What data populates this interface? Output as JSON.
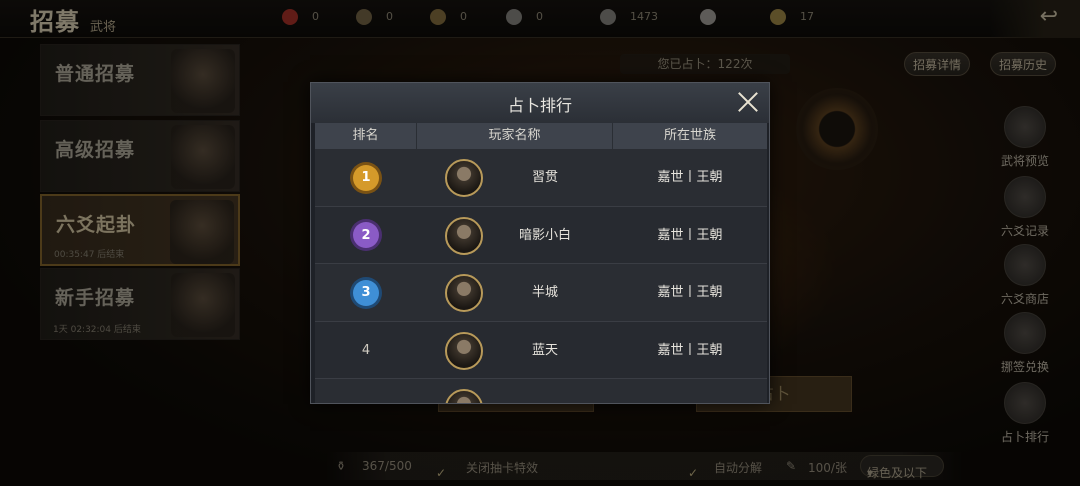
{
  "header": {
    "title": "招募",
    "subtitle": "武将",
    "resources": [
      {
        "icon": "red-token-icon",
        "value": "0",
        "color": "#b0342a"
      },
      {
        "icon": "scroll-icon",
        "value": "0",
        "color": "#7a6b4a"
      },
      {
        "icon": "book-icon",
        "value": "0",
        "color": "#8a7442"
      },
      {
        "icon": "swirl-icon",
        "value": "0",
        "color": "#8d8a86"
      },
      {
        "icon": "feather-icon",
        "value": "1473",
        "color": "#8d8a86"
      },
      {
        "icon": "ingot-silver-icon",
        "value": "",
        "color": "#a9a7a1"
      },
      {
        "icon": "ingot-gold-icon",
        "value": "17",
        "color": "#a78e4a"
      }
    ]
  },
  "recruit_tabs": [
    {
      "label": "普通招募",
      "sub": ""
    },
    {
      "label": "高级招募",
      "sub": ""
    },
    {
      "label": "六爻起卦",
      "sub": "00:35:47 后结束",
      "active": true
    },
    {
      "label": "新手招募",
      "sub": "1天 02:32:04 后结束"
    }
  ],
  "top_actions": {
    "divine_count": "您已占卜：122次",
    "details": "招募详情",
    "history": "招募历史"
  },
  "side_buttons": [
    {
      "label": "武将预览",
      "icon": "general-preview-icon"
    },
    {
      "label": "六爻记录",
      "icon": "record-icon"
    },
    {
      "label": "六爻商店",
      "icon": "shop-icon"
    },
    {
      "label": "挪签兑换",
      "icon": "exchange-icon"
    },
    {
      "label": "占卜排行",
      "icon": "ranking-icon"
    }
  ],
  "background_buttons": {
    "divine": "占卜"
  },
  "bottom": {
    "capacity": "367/500",
    "close_effect": "关闭抽卡特效",
    "auto_decompose": "自动分解",
    "price": "100/张",
    "filter": "绿色及以下"
  },
  "modal": {
    "title": "占卜排行",
    "columns": [
      "排名",
      "玩家名称",
      "所在世族"
    ],
    "rows": [
      {
        "rank": "1",
        "medal_color": "#d59a2a",
        "name": "習贯",
        "clan": "嘉世丨王朝"
      },
      {
        "rank": "2",
        "medal_color": "#8a5bc6",
        "name": "暗影小白",
        "clan": "嘉世丨王朝"
      },
      {
        "rank": "3",
        "medal_color": "#3f8fd6",
        "name": "半城",
        "clan": "嘉世丨王朝"
      },
      {
        "rank": "4",
        "medal_color": "",
        "name": "蓝天",
        "clan": "嘉世丨王朝"
      },
      {
        "rank": "",
        "medal_color": "",
        "name": "",
        "clan": ""
      }
    ]
  }
}
